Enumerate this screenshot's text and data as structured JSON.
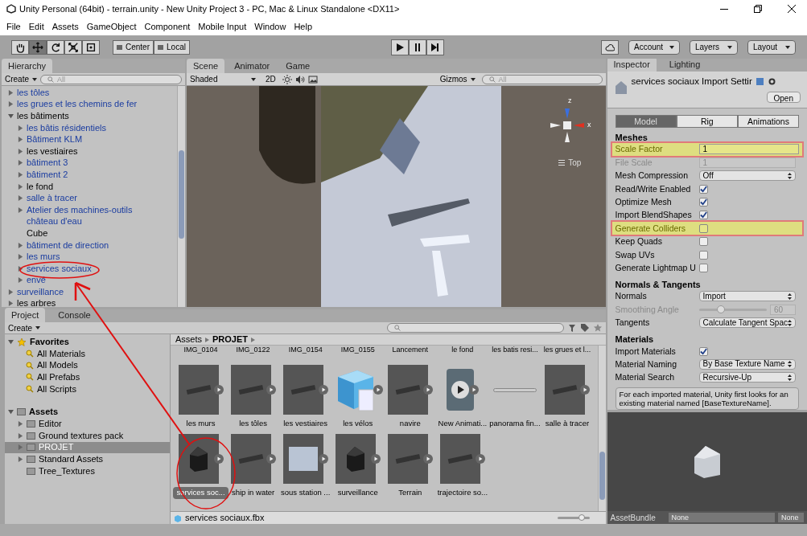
{
  "window": {
    "title": "Unity Personal (64bit) - terrain.unity - New Unity Project 3 - PC, Mac & Linux Standalone <DX11>"
  },
  "menu": [
    "File",
    "Edit",
    "Assets",
    "GameObject",
    "Component",
    "Mobile Input",
    "Window",
    "Help"
  ],
  "toolbar": {
    "tools": [
      {
        "kind": "hand",
        "selected": false
      },
      {
        "kind": "move",
        "selected": true
      },
      {
        "kind": "rotate",
        "selected": false
      },
      {
        "kind": "scale",
        "selected": false
      },
      {
        "kind": "rect",
        "selected": false
      }
    ],
    "pivot": [
      "Center",
      "Local"
    ],
    "dropdowns": [
      "Account",
      "Layers",
      "Layout"
    ]
  },
  "hierarchy": {
    "title": "Hierarchy",
    "create": "Create",
    "search": {
      "placeholder": "All"
    },
    "items": [
      {
        "label": "les tôles",
        "prefab": true,
        "kind": "parent",
        "expanded": false
      },
      {
        "label": "les grues et les chemins de fer",
        "prefab": true,
        "kind": "parent",
        "expanded": false
      },
      {
        "label": "les bâtiments",
        "prefab": false,
        "kind": "parent",
        "expanded": true,
        "children": [
          {
            "label": "les bâtis résidentiels",
            "prefab": true,
            "kind": "parent",
            "expanded": false
          },
          {
            "label": "Bâtiment KLM",
            "prefab": true,
            "kind": "parent",
            "expanded": false
          },
          {
            "label": "les vestiaires",
            "prefab": false,
            "kind": "parent",
            "expanded": false
          },
          {
            "label": "bâtiment 3",
            "prefab": true,
            "kind": "parent",
            "expanded": false
          },
          {
            "label": "bâtiment 2",
            "prefab": true,
            "kind": "parent",
            "expanded": false
          },
          {
            "label": "le fond",
            "prefab": false,
            "kind": "parent",
            "expanded": false
          },
          {
            "label": "salle à tracer",
            "prefab": true,
            "kind": "parent",
            "expanded": false
          },
          {
            "label": "Atelier des machines-outils",
            "prefab": true,
            "kind": "parent",
            "expanded": false
          },
          {
            "label": "château d'eau",
            "prefab": true,
            "kind": "leaf"
          },
          {
            "label": "Cube",
            "prefab": false,
            "kind": "leaf"
          },
          {
            "label": "bâtiment de direction",
            "prefab": true,
            "kind": "parent",
            "expanded": false
          },
          {
            "label": "les murs",
            "prefab": true,
            "kind": "parent",
            "expanded": false
          },
          {
            "label": "services sociaux",
            "prefab": true,
            "kind": "parent",
            "expanded": false
          },
          {
            "label": "envé",
            "prefab": true,
            "kind": "parent",
            "expanded": false
          }
        ]
      },
      {
        "label": "surveillance",
        "prefab": true,
        "kind": "parent",
        "expanded": false
      },
      {
        "label": "les arbres",
        "prefab": false,
        "kind": "parent",
        "expanded": false
      }
    ]
  },
  "scene": {
    "tabs": [
      {
        "label": "Scene",
        "selected": true
      },
      {
        "label": "Animator",
        "selected": false
      },
      {
        "label": "Game",
        "selected": false
      }
    ],
    "shading": "Shaded",
    "mode_2d": "2D",
    "gizmos": "Gizmos",
    "search": {
      "placeholder": "All"
    },
    "gizmo_axes": [
      "z",
      "x"
    ],
    "view": "Top"
  },
  "inspector": {
    "tabs": [
      {
        "label": "Inspector",
        "selected": true
      },
      {
        "label": "Lighting",
        "selected": false
      }
    ],
    "title": "services sociaux Import Settir",
    "open": "Open",
    "subtabs": [
      {
        "label": "Model",
        "selected": true
      },
      {
        "label": "Rig",
        "selected": false
      },
      {
        "label": "Animations",
        "selected": false
      }
    ],
    "sections": [
      {
        "title": "Meshes",
        "rows": [
          {
            "kind": "field",
            "label": "Scale Factor",
            "value": "1",
            "highlighted": true
          },
          {
            "kind": "field",
            "label": "File Scale",
            "value": "1",
            "disabled": true
          },
          {
            "kind": "dropdown",
            "label": "Mesh Compression",
            "value": "Off"
          },
          {
            "kind": "checkbox",
            "label": "Read/Write Enabled",
            "checked": true
          },
          {
            "kind": "checkbox",
            "label": "Optimize Mesh",
            "checked": true
          },
          {
            "kind": "checkbox",
            "label": "Import BlendShapes",
            "checked": true
          },
          {
            "kind": "checkbox",
            "label": "Generate Colliders",
            "checked": false,
            "highlighted": true
          },
          {
            "kind": "checkbox",
            "label": "Keep Quads",
            "checked": false
          },
          {
            "kind": "checkbox",
            "label": "Swap UVs",
            "checked": false
          },
          {
            "kind": "checkbox",
            "label": "Generate Lightmap U",
            "checked": false
          }
        ]
      },
      {
        "title": "Normals & Tangents",
        "rows": [
          {
            "kind": "dropdown",
            "label": "Normals",
            "value": "Import"
          },
          {
            "kind": "slider",
            "label": "Smoothing Angle",
            "level": 0.33,
            "value": "60",
            "disabled": true
          },
          {
            "kind": "dropdown",
            "label": "Tangents",
            "value": "Calculate Tangent Spac"
          }
        ]
      },
      {
        "title": "Materials",
        "rows": [
          {
            "kind": "checkbox",
            "label": "Import Materials",
            "checked": true
          },
          {
            "kind": "dropdown",
            "label": "Material Naming",
            "value": "By Base Texture Name"
          },
          {
            "kind": "dropdown",
            "label": "Material Search",
            "value": "Recursive-Up"
          }
        ]
      }
    ],
    "help": "For each imported material, Unity first looks for an existing material named [BaseTextureName].",
    "asset_bundle": {
      "label": "AssetBundle",
      "values": [
        "None",
        "None"
      ]
    }
  },
  "project": {
    "tabs": [
      {
        "label": "Project",
        "selected": true
      },
      {
        "label": "Console",
        "selected": false
      }
    ],
    "create": "Create",
    "favorites": {
      "label": "Favorites",
      "items": [
        "All Materials",
        "All Models",
        "All Prefabs",
        "All Scripts"
      ]
    },
    "assets": {
      "label": "Assets",
      "items": [
        {
          "label": "Editor",
          "kind": "parent",
          "selected": false
        },
        {
          "label": "Ground textures pack",
          "kind": "parent",
          "selected": false
        },
        {
          "label": "PROJET",
          "kind": "parent",
          "selected": true
        },
        {
          "label": "Standard Assets",
          "kind": "parent",
          "selected": false
        },
        {
          "label": "Tree_Textures",
          "kind": "leaf",
          "selected": false
        }
      ]
    },
    "breadcrumb": [
      "Assets",
      "PROJET"
    ],
    "top_labels": [
      "IMG_0104",
      "IMG_0122",
      "IMG_0154",
      "IMG_0155",
      "Lancement",
      "le fond",
      "les batis resi...",
      "les grues et l..."
    ],
    "grid": [
      {
        "label": "les murs",
        "kind": "model",
        "selected": false
      },
      {
        "label": "les tôles",
        "kind": "model",
        "selected": false
      },
      {
        "label": "les vestiaires",
        "kind": "model",
        "selected": false
      },
      {
        "label": "les vélos",
        "kind": "prefab",
        "selected": false
      },
      {
        "label": "navire",
        "kind": "model",
        "selected": false
      },
      {
        "label": "New Animati...",
        "kind": "animation",
        "selected": false
      },
      {
        "label": "panorama fin...",
        "kind": "strip",
        "selected": false
      },
      {
        "label": "salle à tracer",
        "kind": "model",
        "selected": false
      },
      {
        "label": "services soc...",
        "kind": "house",
        "selected": true
      },
      {
        "label": "ship in water",
        "kind": "model",
        "selected": false
      },
      {
        "label": "sous station ...",
        "kind": "box",
        "selected": false
      },
      {
        "label": "surveillance",
        "kind": "house",
        "selected": false
      },
      {
        "label": "Terrain",
        "kind": "model",
        "selected": false
      },
      {
        "label": "trajectoire so...",
        "kind": "model",
        "selected": false
      }
    ],
    "path": "services sociaux.fbx",
    "thumbnail_size": {
      "level": 0.75
    }
  }
}
